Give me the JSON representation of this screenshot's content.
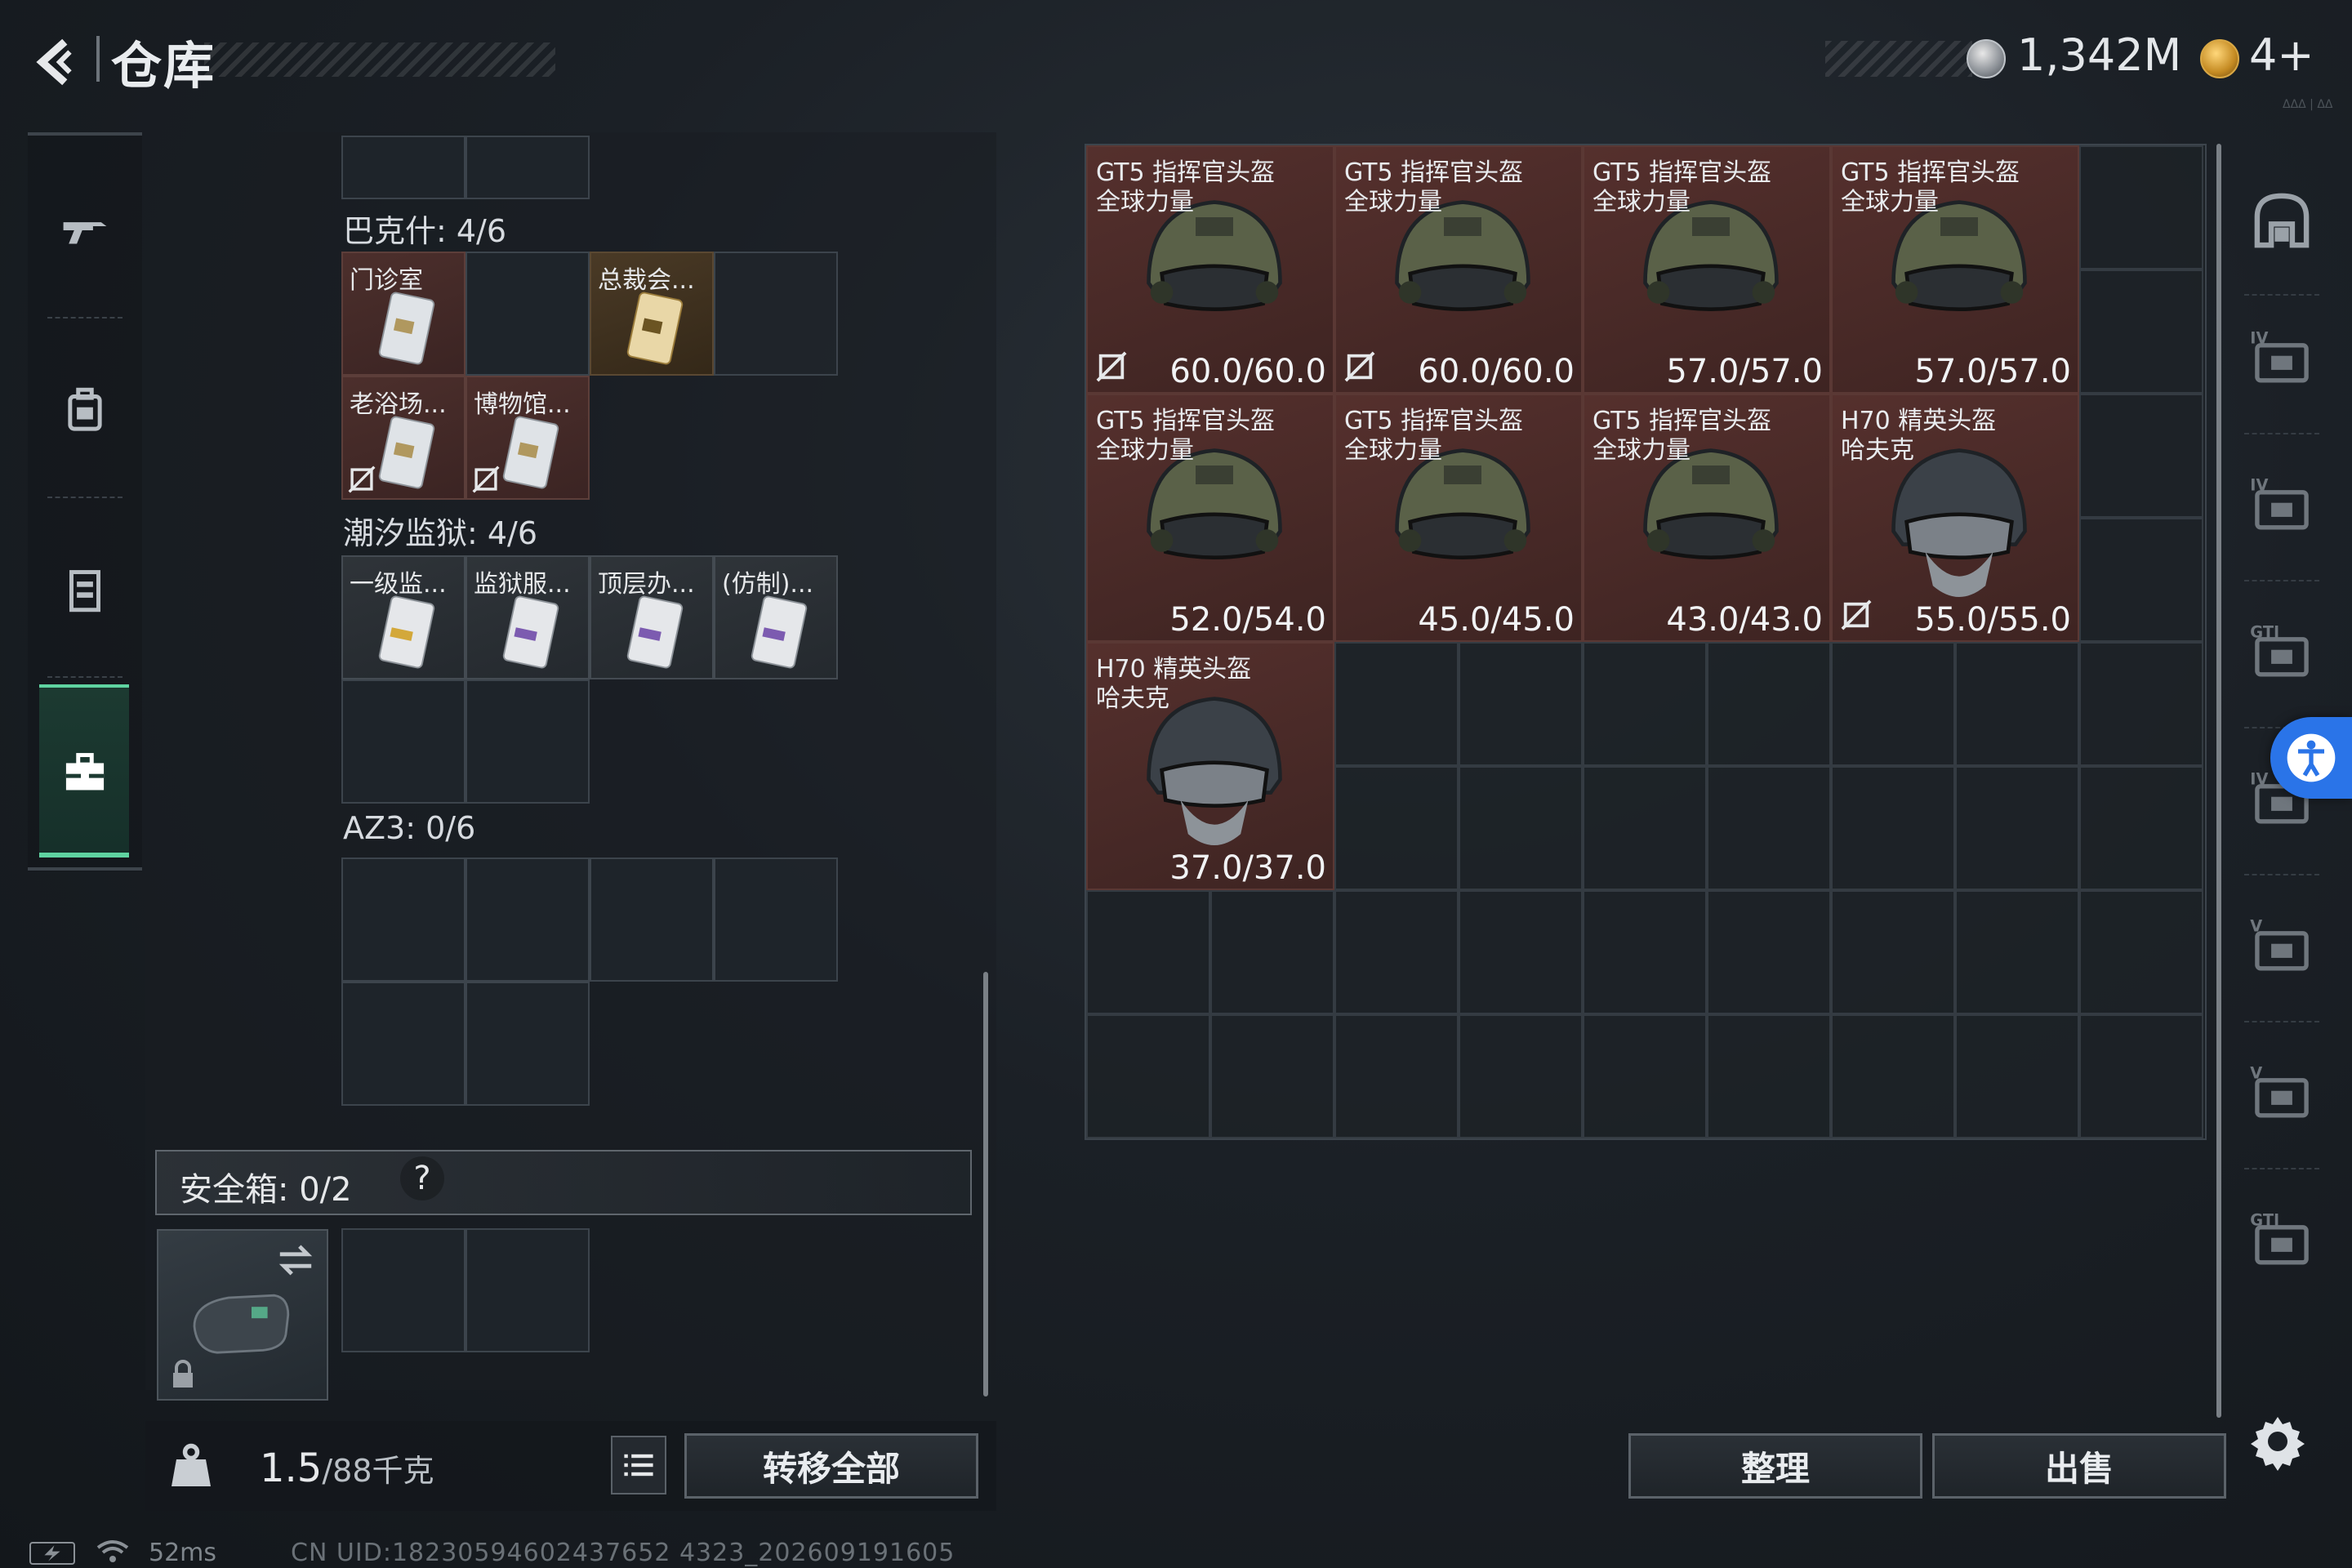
{
  "header": {
    "title": "仓库",
    "coins": "1,342M",
    "tickets": "4+",
    "tiny_mark": "ΔΔΔ | ΔΔ"
  },
  "colors": {
    "accent_green": "#5fd3a1",
    "item_red": "#55302d",
    "access_blue": "#2a74e8"
  },
  "left_nav": {
    "items": [
      {
        "name": "weapons",
        "icon": "gun-icon"
      },
      {
        "name": "equipment",
        "icon": "backpack-icon"
      },
      {
        "name": "vest",
        "icon": "vest-icon"
      },
      {
        "name": "keys",
        "icon": "briefcase-icon",
        "active": true
      }
    ]
  },
  "backpack": {
    "sections": [
      {
        "title": "巴克什: 4/6",
        "items": [
          "门诊室",
          "总裁会...",
          "老浴场...",
          "博物馆..."
        ]
      },
      {
        "title": "潮汐监狱: 4/6",
        "items": [
          "一级监...",
          "监狱服...",
          "顶层办...",
          "(仿制)..."
        ]
      },
      {
        "title": "AZ3: 0/6",
        "items": []
      }
    ],
    "safe_box_label": "安全箱: 0/2",
    "safe_help": "?",
    "weight_value": "1.5",
    "weight_unit": "/88千克",
    "transfer_all": "转移全部"
  },
  "stash": {
    "items": [
      {
        "name_line1": "GT5 指挥官头盔",
        "name_line2": "全球力量",
        "durability": "60.0/60.0",
        "no_sell": true,
        "type": "gt5"
      },
      {
        "name_line1": "GT5 指挥官头盔",
        "name_line2": "全球力量",
        "durability": "60.0/60.0",
        "no_sell": true,
        "type": "gt5"
      },
      {
        "name_line1": "GT5 指挥官头盔",
        "name_line2": "全球力量",
        "durability": "57.0/57.0",
        "no_sell": false,
        "type": "gt5"
      },
      {
        "name_line1": "GT5 指挥官头盔",
        "name_line2": "全球力量",
        "durability": "57.0/57.0",
        "no_sell": false,
        "type": "gt5"
      },
      {
        "name_line1": "GT5 指挥官头盔",
        "name_line2": "全球力量",
        "durability": "52.0/54.0",
        "no_sell": false,
        "type": "gt5"
      },
      {
        "name_line1": "GT5 指挥官头盔",
        "name_line2": "全球力量",
        "durability": "45.0/45.0",
        "no_sell": false,
        "type": "gt5"
      },
      {
        "name_line1": "GT5 指挥官头盔",
        "name_line2": "全球力量",
        "durability": "43.0/43.0",
        "no_sell": false,
        "type": "gt5"
      },
      {
        "name_line1": "H70 精英头盔",
        "name_line2": "哈夫克",
        "durability": "55.0/55.0",
        "no_sell": true,
        "type": "h70"
      },
      {
        "name_line1": "H70 精英头盔",
        "name_line2": "哈夫克",
        "durability": "37.0/37.0",
        "no_sell": false,
        "type": "h70"
      }
    ],
    "sort_label": "整理",
    "sell_label": "出售"
  },
  "right_rail": {
    "items": [
      "helmet-slot-icon",
      "level-iv-bag-icon",
      "level-iv-medkit-icon",
      "gti-case-icon",
      "level-iv-case-icon",
      "level-v-case-icon",
      "level-v-case-2-icon",
      "gti-box-icon"
    ],
    "marks": [
      "IV",
      "IV",
      "GTI",
      "IV",
      "V",
      "V",
      "GTI"
    ]
  },
  "status_bar": {
    "ping": "52ms",
    "uid": "CN UID:18230594602437652 4323_202609191605"
  }
}
